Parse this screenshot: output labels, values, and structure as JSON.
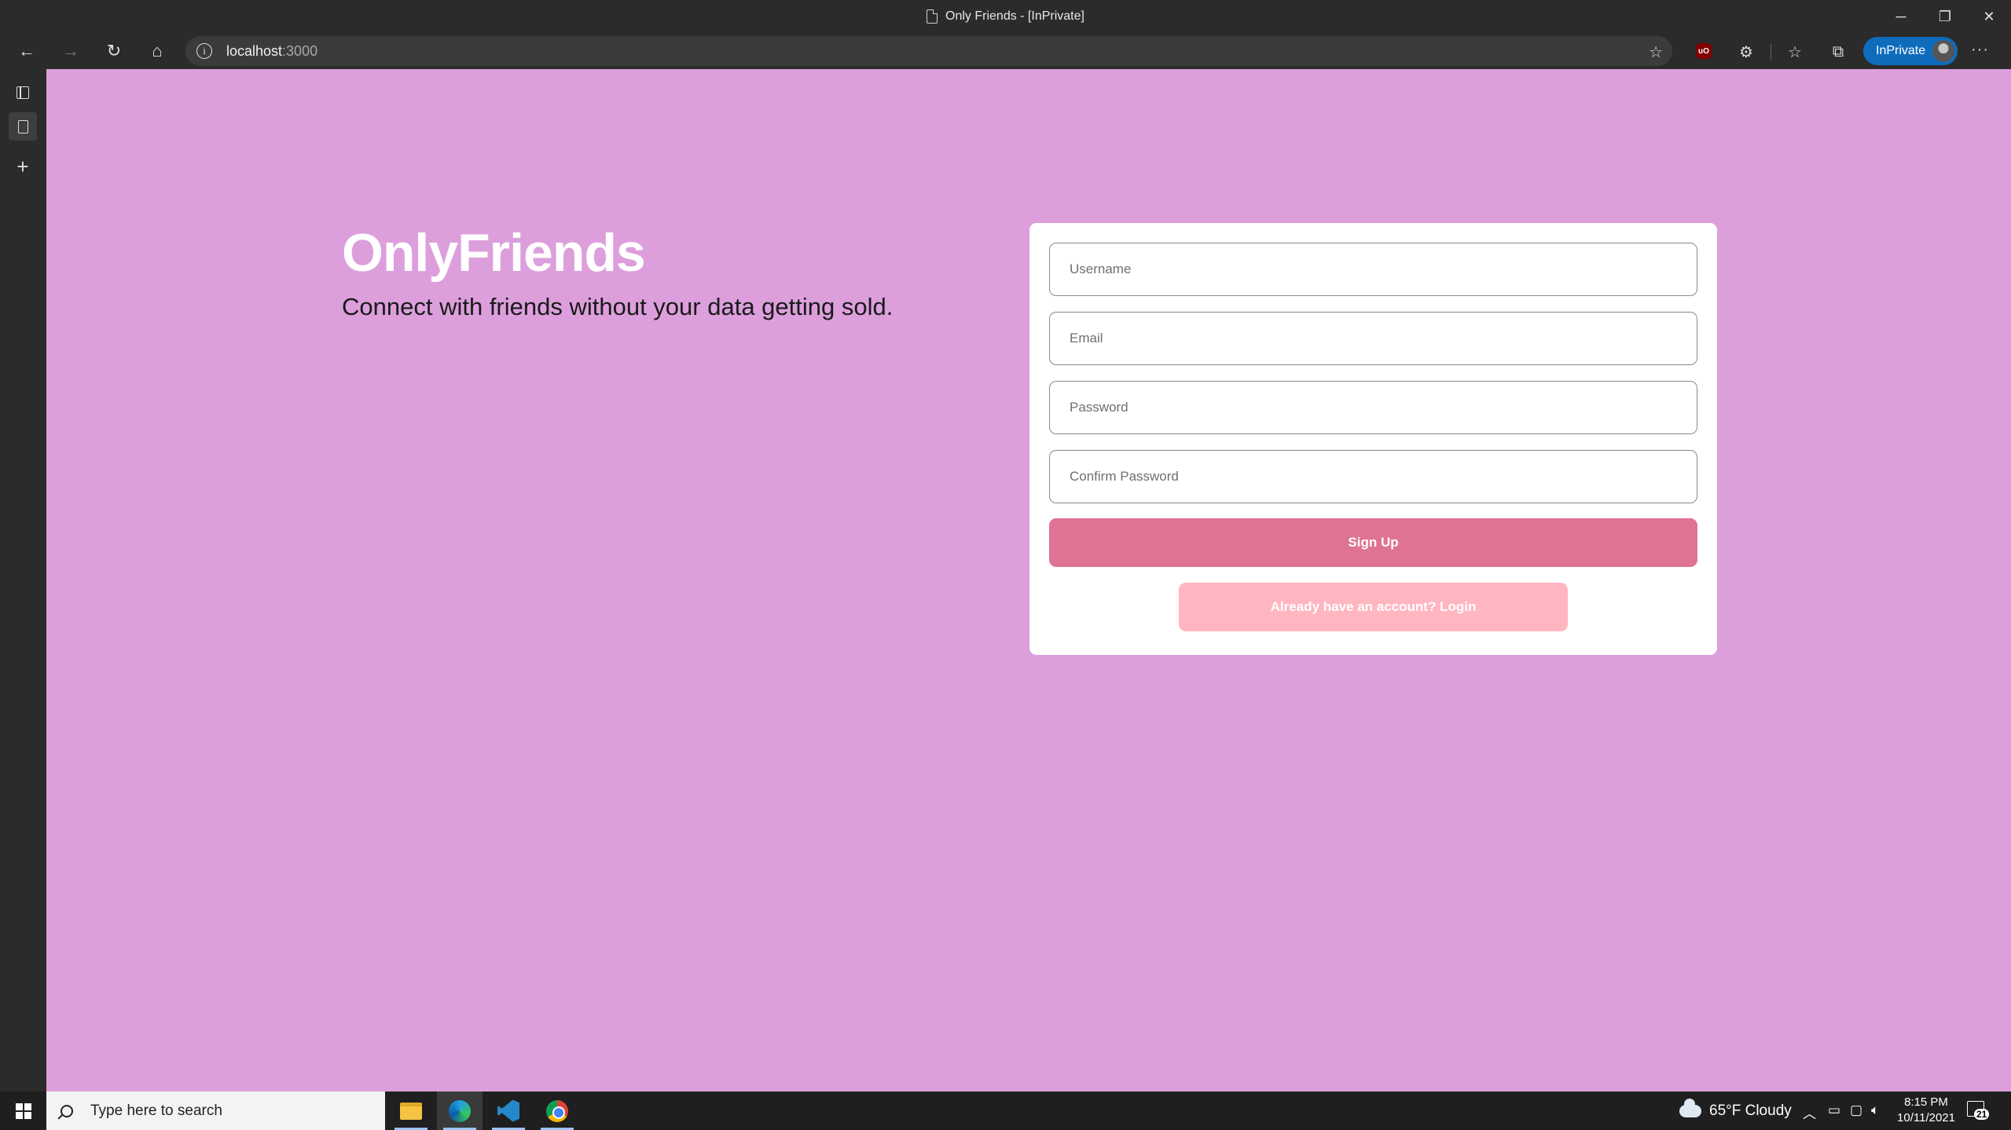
{
  "window": {
    "title": "Only Friends - [InPrivate]",
    "controls": {
      "minimize": "─",
      "restore": "❐",
      "close": "✕"
    }
  },
  "browser": {
    "url_host": "localhost",
    "url_port": ":3000",
    "inprivate_label": "InPrivate",
    "ublock_label": "uO",
    "more_label": "···",
    "nav_icons": {
      "back": "←",
      "forward": "→",
      "refresh": "↻",
      "home": "⌂"
    },
    "toolbar_icons": {
      "favorite": "☆",
      "extensions": "⚙",
      "favorites": "☆",
      "collections": "⧉"
    }
  },
  "sidebar": {
    "new_tab_label": "+"
  },
  "page": {
    "brand": "OnlyFriends",
    "tagline": "Connect with friends without your data getting sold.",
    "form": {
      "username_placeholder": "Username",
      "email_placeholder": "Email",
      "password_placeholder": "Password",
      "confirm_password_placeholder": "Confirm Password",
      "signup_label": "Sign Up",
      "login_label": "Already have an account? Login"
    },
    "colors": {
      "background": "#dc9fdc",
      "signup_button": "#df7394",
      "login_button": "#ffb6c1"
    }
  },
  "taskbar": {
    "search_placeholder": "Type here to search",
    "weather": "65°F  Cloudy",
    "time": "8:15 PM",
    "date": "10/11/2021",
    "notification_count": "21",
    "apps": [
      "file-explorer",
      "edge",
      "vscode",
      "chrome"
    ]
  }
}
